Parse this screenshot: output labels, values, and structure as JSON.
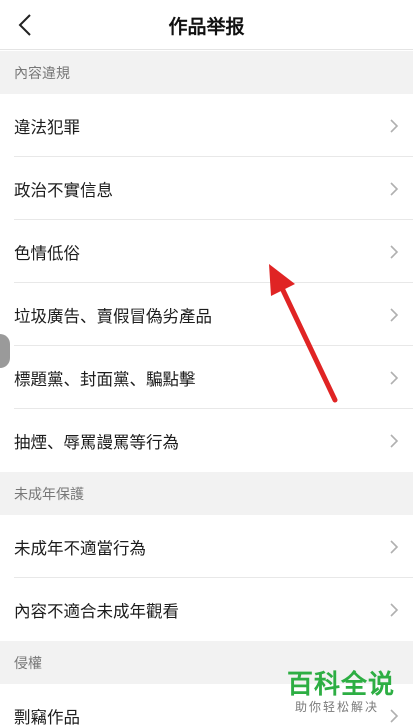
{
  "header": {
    "title": "作品举报",
    "back_icon": "chevron-left-icon"
  },
  "sections": [
    {
      "title": "內容違規",
      "items": [
        {
          "label": "違法犯罪"
        },
        {
          "label": "政治不實信息"
        },
        {
          "label": "色情低俗"
        },
        {
          "label": "垃圾廣告、賣假冒偽劣產品"
        },
        {
          "label": "標題黨、封面黨、騙點擊"
        },
        {
          "label": "抽煙、辱罵謾罵等行為"
        }
      ]
    },
    {
      "title": "未成年保護",
      "items": [
        {
          "label": "未成年不適當行為"
        },
        {
          "label": "內容不適合未成年觀看"
        }
      ]
    },
    {
      "title": "侵權",
      "items": [
        {
          "label": "剽竊作品"
        }
      ]
    }
  ],
  "watermark": {
    "main": "百科全说",
    "sub": "助你轻松解决"
  },
  "colors": {
    "section_bg": "#f2f2f2",
    "arrow": "#e02424",
    "watermark": "#2dae43"
  }
}
